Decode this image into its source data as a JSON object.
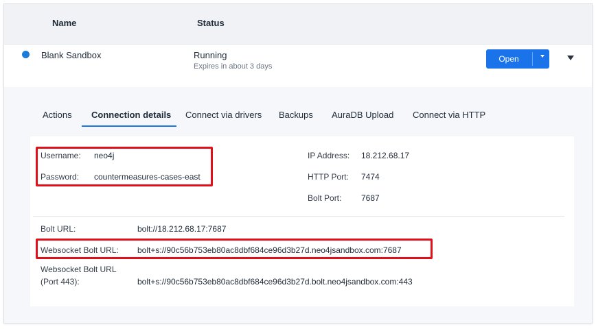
{
  "table": {
    "headers": {
      "name": "Name",
      "status": "Status"
    },
    "row": {
      "name": "Blank Sandbox",
      "status": "Running",
      "expires": "Expires in about 3 days",
      "open_label": "Open",
      "status_color": "#1b7bd9"
    }
  },
  "tabs": [
    {
      "label": "Actions",
      "active": false
    },
    {
      "label": "Connection details",
      "active": true
    },
    {
      "label": "Connect via drivers",
      "active": false
    },
    {
      "label": "Backups",
      "active": false
    },
    {
      "label": "AuraDB Upload",
      "active": false
    },
    {
      "label": "Connect via HTTP",
      "active": false
    }
  ],
  "credentials": {
    "username_label": "Username:",
    "username": "neo4j",
    "password_label": "Password:",
    "password": "countermeasures-cases-east"
  },
  "network": {
    "ip_label": "IP Address:",
    "ip": "18.212.68.17",
    "http_port_label": "HTTP Port:",
    "http_port": "7474",
    "bolt_port_label": "Bolt Port:",
    "bolt_port": "7687"
  },
  "urls": {
    "bolt_url_label": "Bolt URL:",
    "bolt_url": "bolt://18.212.68.17:7687",
    "ws_bolt_url_label": "Websocket Bolt URL:",
    "ws_bolt_url": "bolt+s://90c56b753eb80ac8dbf684ce96d3b27d.neo4jsandbox.com:7687",
    "ws_bolt_443_label_line1": "Websocket Bolt URL",
    "ws_bolt_443_label_line2": "(Port 443):",
    "ws_bolt_443_url": "bolt+s://90c56b753eb80ac8dbf684ce96d3b27d.bolt.neo4jsandbox.com:443"
  },
  "colors": {
    "accent": "#1a73e8",
    "highlight": "#e0101a"
  }
}
